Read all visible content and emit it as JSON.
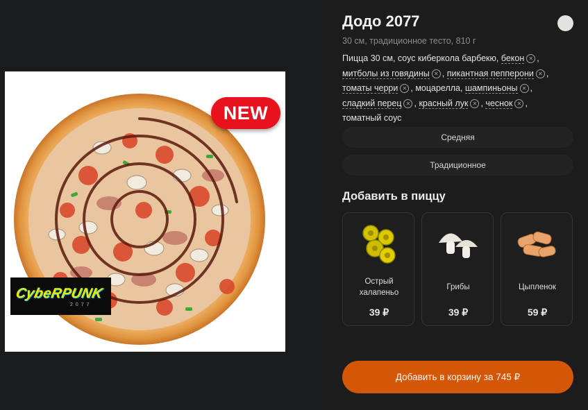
{
  "image": {
    "badge": "NEW",
    "logo_text": "CybeRPUNK",
    "logo_sub": "2077"
  },
  "product": {
    "title": "Додо 2077",
    "subtitle": "30 см, традиционное тесто, 810 г",
    "ingredients": [
      {
        "text": "Пицца 30 см, соус киберкола барбекю, ",
        "removable": false
      },
      {
        "text": "бекон",
        "removable": true,
        "sep": ","
      },
      {
        "text": "митболы из говядины",
        "removable": true,
        "sep": ","
      },
      {
        "text": "пикантная пепперони",
        "removable": true,
        "sep": ","
      },
      {
        "text": "томаты черри",
        "removable": true,
        "sep": ","
      },
      {
        "text": "моцарелла, ",
        "removable": false
      },
      {
        "text": "шампиньоны",
        "removable": true,
        "sep": ","
      },
      {
        "text": "сладкий перец",
        "removable": true,
        "sep": ","
      },
      {
        "text": "красный лук",
        "removable": true,
        "sep": ","
      },
      {
        "text": "чеснок",
        "removable": true,
        "sep": ","
      },
      {
        "text": "томатный соус",
        "removable": false
      }
    ],
    "size_option": "Средняя",
    "dough_option": "Традиционное"
  },
  "addons": {
    "title": "Добавить в пиццу",
    "items": [
      {
        "name": "Острый халапеньо",
        "price": "39 ₽",
        "icon": "jalapeno-icon"
      },
      {
        "name": "Грибы",
        "price": "39 ₽",
        "icon": "mushroom-icon"
      },
      {
        "name": "Цыпленок",
        "price": "59 ₽",
        "icon": "chicken-icon"
      }
    ]
  },
  "cart": {
    "label": "Добавить в корзину за 745 ₽"
  },
  "colors": {
    "accent": "#d45707",
    "badge": "#e8121e",
    "background": "#1c1c1c"
  }
}
